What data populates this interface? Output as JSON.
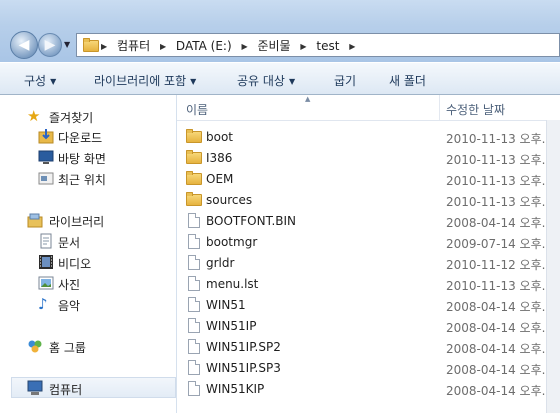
{
  "addressbar": {
    "crumbs": [
      "컴퓨터",
      "DATA (E:)",
      "준비물",
      "test"
    ]
  },
  "toolbar": {
    "organize": "구성",
    "include_library": "라이브러리에 포함",
    "share_with": "공유 대상",
    "burn": "굽기",
    "new_folder": "새 폴더"
  },
  "nav": {
    "favorites": {
      "label": "즐겨찾기",
      "items": [
        "다운로드",
        "바탕 화면",
        "최근 위치"
      ]
    },
    "libraries": {
      "label": "라이브러리",
      "items": [
        "문서",
        "비디오",
        "사진",
        "음악"
      ]
    },
    "homegroup": "홈 그룹",
    "computer": "컴퓨터"
  },
  "columns": {
    "name": "이름",
    "date": "수정한 날짜"
  },
  "files": [
    {
      "name": "boot",
      "type": "folder",
      "date": "2010-11-13 오후..."
    },
    {
      "name": "I386",
      "type": "folder",
      "date": "2010-11-13 오후..."
    },
    {
      "name": "OEM",
      "type": "folder",
      "date": "2010-11-13 오후..."
    },
    {
      "name": "sources",
      "type": "folder",
      "date": "2010-11-13 오후..."
    },
    {
      "name": "BOOTFONT.BIN",
      "type": "file",
      "date": "2008-04-14 오후..."
    },
    {
      "name": "bootmgr",
      "type": "file",
      "date": "2009-07-14 오후..."
    },
    {
      "name": "grldr",
      "type": "file",
      "date": "2010-11-12 오후..."
    },
    {
      "name": "menu.lst",
      "type": "file",
      "date": "2010-11-13 오후..."
    },
    {
      "name": "WIN51",
      "type": "file",
      "date": "2008-04-14 오후..."
    },
    {
      "name": "WIN51IP",
      "type": "file",
      "date": "2008-04-14 오후..."
    },
    {
      "name": "WIN51IP.SP2",
      "type": "file",
      "date": "2008-04-14 오후..."
    },
    {
      "name": "WIN51IP.SP3",
      "type": "file",
      "date": "2008-04-14 오후..."
    },
    {
      "name": "WIN51KIP",
      "type": "file",
      "date": "2008-04-14 오후..."
    }
  ]
}
